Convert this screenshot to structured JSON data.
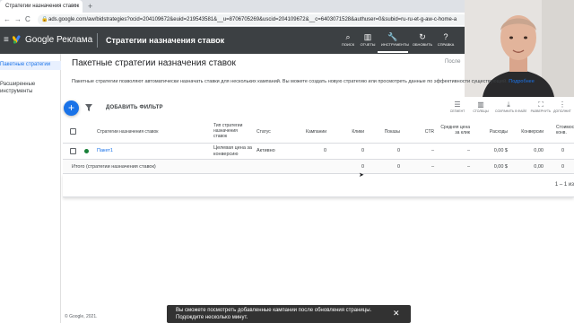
{
  "browser": {
    "tab_title": "Стратегии назначения ставок",
    "tab_close": "×",
    "new_tab": "+",
    "back": "←",
    "forward": "→",
    "reload": "C",
    "url": "ads.google.com/aw/bidstrategies?ocid=204109672&euid=219543581&__u=8706705269&uscid=204109672&__c=6403071528&authuser=0&subid=ru-ru-et-g-aw-c-home-a"
  },
  "header": {
    "menu_icon": "≡",
    "brand": "Google Реклама",
    "page_title": "Стратегии назначения ставок",
    "buttons": [
      {
        "icon": "search-icon",
        "glyph": "⌕",
        "label": "ПОИСК"
      },
      {
        "icon": "reports-icon",
        "glyph": "▥",
        "label": "ОТЧЕТЫ"
      },
      {
        "icon": "wrench-icon",
        "glyph": "🔧",
        "label": "ИНСТРУМЕНТЫ"
      },
      {
        "icon": "refresh-icon",
        "glyph": "↻",
        "label": "ОБНОВИТЬ"
      },
      {
        "icon": "help-icon",
        "glyph": "?",
        "label": "СПРАВКА"
      }
    ]
  },
  "sidebar": {
    "items": [
      {
        "label": "Пакетные стратегии"
      },
      {
        "label": "Расширенные"
      },
      {
        "label": "инструменты"
      }
    ]
  },
  "main": {
    "title": "Пакетные стратегии назначения ставок",
    "last_label": "После",
    "description": "Пакетные стратегии позволяют автоматически назначать ставки для нескольких кампаний. Вы можете создать новую стратегию или просмотреть данные по эффективности существующей.",
    "description_link": "Подробнее",
    "fab": "+",
    "add_filter": "ДОБАВИТЬ ФИЛЬТР",
    "tools": [
      {
        "glyph": "☰",
        "label": "СЕГМЕНТ"
      },
      {
        "glyph": "▥",
        "label": "СТОЛБЦЫ"
      },
      {
        "glyph": "⤓",
        "label": "СОХРАНИТЬ В ФАЙЛ"
      },
      {
        "glyph": "⛶",
        "label": "РАЗВЕРНУТЬ"
      },
      {
        "glyph": "⋮",
        "label": "ДОПОЛНИТ"
      }
    ]
  },
  "table": {
    "headers": {
      "name": "Стратегии назначения ставок",
      "type": "Тип стратегии назначения ставок",
      "status": "Статус",
      "campaigns": "Кампании",
      "clicks": "Клики",
      "impressions": "Показы",
      "ctr": "CTR",
      "avg_cpc": "Средняя цена за клик",
      "cost": "Расходы",
      "conversions": "Конверсии",
      "cost_conv": "Стоимость/конв."
    },
    "row": {
      "name": "Пакет1",
      "type": "Целевая цена за конверсию",
      "status": "Активно",
      "campaigns": "0",
      "clicks": "0",
      "impressions": "0",
      "ctr": "–",
      "avg_cpc": "–",
      "cost": "0,00 $",
      "conversions": "0,00",
      "cost_conv": "0"
    },
    "total": {
      "name": "Итого (стратегии назначения ставок)",
      "clicks": "0",
      "impressions": "0",
      "ctr": "–",
      "avg_cpc": "–",
      "cost": "0,00 $",
      "conversions": "0,00",
      "cost_conv": "0"
    },
    "pager": "1 – 1 из"
  },
  "footer": "© Google, 2021.",
  "toast": {
    "text": "Вы сможете посмотреть добавленные кампании после обновления страницы. Подождите несколько минут.",
    "close": "✕"
  },
  "colors": {
    "header_bg": "#3c4043",
    "accent": "#1a73e8",
    "status_green": "#188038",
    "toast_bg": "#323232"
  }
}
